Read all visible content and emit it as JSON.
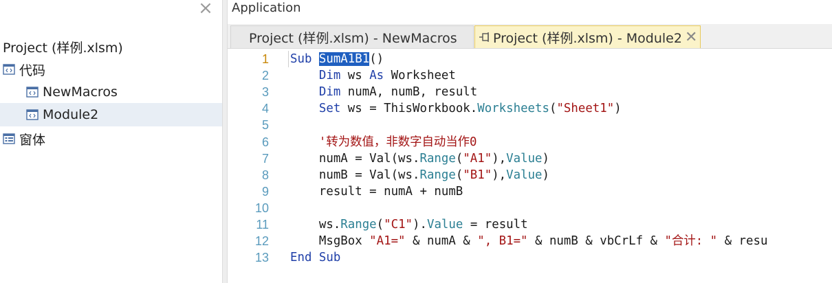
{
  "left_pane": {
    "close_glyph": "×",
    "project_title": "Project (样例.xlsm)",
    "tree": [
      {
        "label": "代码",
        "icon": "code-folder-icon",
        "indent": 0,
        "selected": false
      },
      {
        "label": "NewMacros",
        "icon": "module-icon",
        "indent": 1,
        "selected": false
      },
      {
        "label": "Module2",
        "icon": "module-icon",
        "indent": 1,
        "selected": true
      },
      {
        "label": "窗体",
        "icon": "form-icon",
        "indent": 0,
        "selected": false
      }
    ]
  },
  "editor": {
    "app_title": "Application",
    "tabs": [
      {
        "label": "Project (样例.xlsm) - NewMacros",
        "active": false
      },
      {
        "label": "Project (样例.xlsm) - Module2",
        "active": true,
        "close_glyph": "✕"
      }
    ],
    "current_line": 1,
    "lines": [
      {
        "n": "1",
        "tokens": [
          [
            "kw",
            "Sub "
          ],
          [
            "sel",
            "SumA1B1"
          ],
          [
            "plain",
            "()"
          ]
        ]
      },
      {
        "n": "2",
        "tokens": [
          [
            "plain",
            "    "
          ],
          [
            "kw",
            "Dim "
          ],
          [
            "plain",
            "ws "
          ],
          [
            "kw",
            "As "
          ],
          [
            "plain",
            "Worksheet"
          ]
        ]
      },
      {
        "n": "3",
        "tokens": [
          [
            "plain",
            "    "
          ],
          [
            "kw",
            "Dim "
          ],
          [
            "plain",
            "numA, numB, result"
          ]
        ]
      },
      {
        "n": "4",
        "tokens": [
          [
            "plain",
            "    "
          ],
          [
            "kw",
            "Set "
          ],
          [
            "plain",
            "ws = ThisWorkbook."
          ],
          [
            "mem",
            "Worksheets"
          ],
          [
            "plain",
            "("
          ],
          [
            "str",
            "\"Sheet1\""
          ],
          [
            "plain",
            ")"
          ]
        ]
      },
      {
        "n": "5",
        "tokens": []
      },
      {
        "n": "6",
        "tokens": [
          [
            "plain",
            "    "
          ],
          [
            "cmt",
            "'转为数值，非数字自动当作0"
          ]
        ]
      },
      {
        "n": "7",
        "tokens": [
          [
            "plain",
            "    numA = Val(ws."
          ],
          [
            "mem",
            "Range"
          ],
          [
            "plain",
            "("
          ],
          [
            "str",
            "\"A1\""
          ],
          [
            "plain",
            "),"
          ],
          [
            "mem",
            "Value"
          ],
          [
            "plain",
            ")"
          ]
        ]
      },
      {
        "n": "8",
        "tokens": [
          [
            "plain",
            "    numB = Val(ws."
          ],
          [
            "mem",
            "Range"
          ],
          [
            "plain",
            "("
          ],
          [
            "str",
            "\"B1\""
          ],
          [
            "plain",
            "),"
          ],
          [
            "mem",
            "Value"
          ],
          [
            "plain",
            ")"
          ]
        ]
      },
      {
        "n": "9",
        "tokens": [
          [
            "plain",
            "    result = numA + numB"
          ]
        ]
      },
      {
        "n": "10",
        "tokens": []
      },
      {
        "n": "11",
        "tokens": [
          [
            "plain",
            "    ws."
          ],
          [
            "mem",
            "Range"
          ],
          [
            "plain",
            "("
          ],
          [
            "str",
            "\"C1\""
          ],
          [
            "plain",
            ")."
          ],
          [
            "mem",
            "Value"
          ],
          [
            "plain",
            " = result"
          ]
        ]
      },
      {
        "n": "12",
        "tokens": [
          [
            "plain",
            "    MsgBox "
          ],
          [
            "str",
            "\"A1=\""
          ],
          [
            "plain",
            " & numA & "
          ],
          [
            "str",
            "\", B1=\""
          ],
          [
            "plain",
            " & numB & vbCrLf & "
          ],
          [
            "str",
            "\"合计: \""
          ],
          [
            "plain",
            " & resu"
          ]
        ]
      },
      {
        "n": "13",
        "tokens": [
          [
            "kw",
            "End Sub"
          ]
        ]
      }
    ]
  },
  "colors": {
    "keyword": "#1f3fa8",
    "string": "#a31515",
    "member": "#2b7f93",
    "selection": "#1f5fc0",
    "active_tab": "#fbf3c9",
    "line_number": "#5a9bbd",
    "current_line_number": "#c8880a"
  }
}
